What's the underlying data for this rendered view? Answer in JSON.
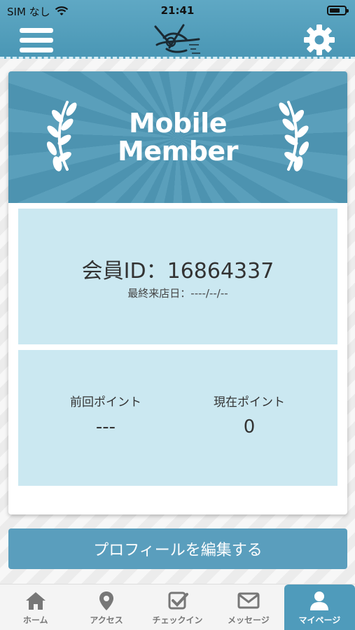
{
  "status_bar": {
    "carrier": "SIM なし",
    "time": "21:41"
  },
  "header": {
    "menu_icon": "hamburger-menu-icon",
    "settings_icon": "gear-icon",
    "logo": "shop-logo"
  },
  "card": {
    "banner_title_line1": "Mobile",
    "banner_title_line2": "Member",
    "member_id_text": "会員ID：16864337",
    "last_visit_text": "最終来店日：----/--/--",
    "previous_points_label": "前回ポイント",
    "previous_points_value": "---",
    "current_points_label": "現在ポイント",
    "current_points_value": "0"
  },
  "edit_profile_label": "プロフィールを編集する",
  "tabs": [
    {
      "label": "ホーム",
      "icon": "home-icon"
    },
    {
      "label": "アクセス",
      "icon": "map-pin-icon"
    },
    {
      "label": "チェックイン",
      "icon": "checkbox-icon"
    },
    {
      "label": "メッセージ",
      "icon": "envelope-icon"
    },
    {
      "label": "マイページ",
      "icon": "user-icon",
      "active": true
    }
  ],
  "colors": {
    "accent": "#4f9bbb",
    "panel": "#cbe8f1"
  }
}
